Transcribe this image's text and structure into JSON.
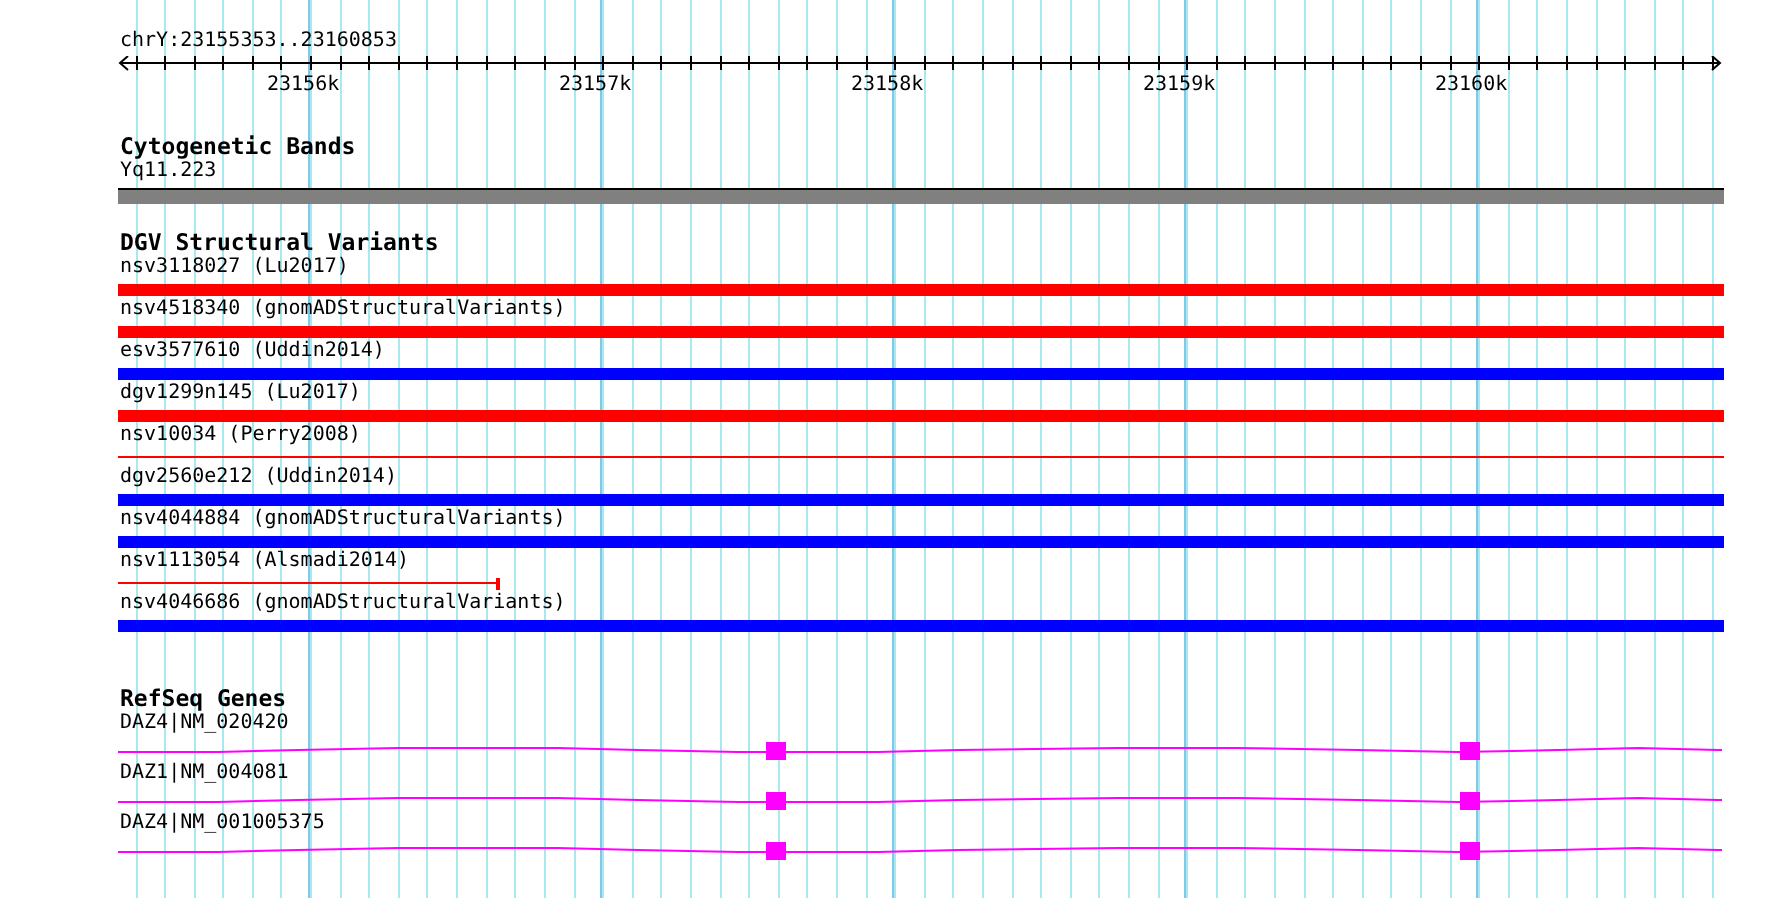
{
  "ruler": {
    "location": "chrY:23155353..23160853",
    "ticks": [
      "23156k",
      "23157k",
      "23158k",
      "23159k",
      "23160k"
    ]
  },
  "cytoband_track": {
    "title": "Cytogenetic Bands",
    "bands": [
      {
        "label": "Yq11.223"
      }
    ]
  },
  "dgv_track": {
    "title": "DGV Structural Variants",
    "variants": [
      {
        "label": "nsv3118027 (Lu2017)",
        "color": "#ff0000",
        "kind": "thick"
      },
      {
        "label": "nsv4518340 (gnomADStructuralVariants)",
        "color": "#ff0000",
        "kind": "thick"
      },
      {
        "label": "esv3577610 (Uddin2014)",
        "color": "#0000ff",
        "kind": "thick"
      },
      {
        "label": "dgv1299n145 (Lu2017)",
        "color": "#ff0000",
        "kind": "thick"
      },
      {
        "label": "nsv10034 (Perry2008)",
        "color": "#ff0000",
        "kind": "thin"
      },
      {
        "label": "dgv2560e212 (Uddin2014)",
        "color": "#0000ff",
        "kind": "thick"
      },
      {
        "label": "nsv4044884 (gnomADStructuralVariants)",
        "color": "#0000ff",
        "kind": "thick"
      },
      {
        "label": "nsv1113054 (Alsmadi2014)",
        "color": "#ff0000",
        "kind": "partial"
      },
      {
        "label": "nsv4046686 (gnomADStructuralVariants)",
        "color": "#0000ff",
        "kind": "thick"
      }
    ]
  },
  "refseq_track": {
    "title": "RefSeq Genes",
    "genes": [
      {
        "label": "DAZ4|NM_020420"
      },
      {
        "label": "DAZ1|NM_004081"
      },
      {
        "label": "DAZ4|NM_001005375"
      }
    ]
  }
}
